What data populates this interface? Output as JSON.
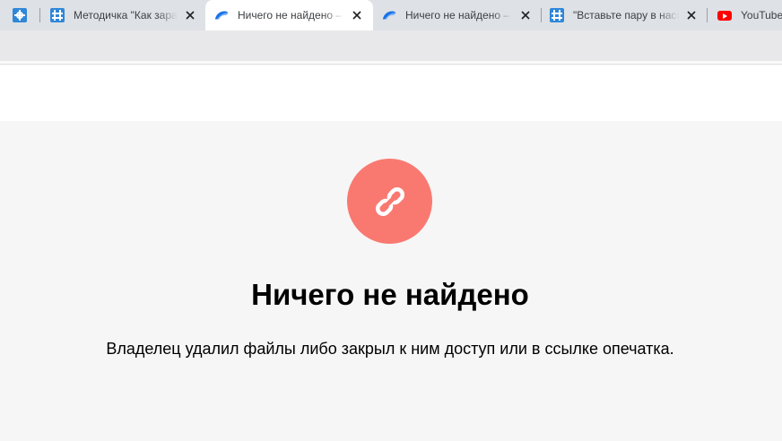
{
  "browser": {
    "tabs": [
      {
        "title": "",
        "favicon": "grid-favicon-icon",
        "active": false
      },
      {
        "title": "Методичка \"Как заработать\"",
        "favicon": "grid-favicon-icon",
        "active": false
      },
      {
        "title": "Ничего не найдено – Яндекс.Диск",
        "favicon": "yandex-disk-icon",
        "active": true
      },
      {
        "title": "Ничего не найдено – Яндекс.Диск",
        "favicon": "yandex-disk-icon",
        "active": false
      },
      {
        "title": "\"Вставьте пару в насос\"",
        "favicon": "grid-favicon-icon",
        "active": false
      },
      {
        "title": "YouTube",
        "favicon": "youtube-icon",
        "active": false
      }
    ]
  },
  "page": {
    "icon": "broken-link-icon",
    "icon_color": "#f97971",
    "title": "Ничего не найдено",
    "message": "Владелец удалил файлы либо закрыл к ним доступ или в ссылке опечатка."
  },
  "colors": {
    "tab_strip": "#dee1e6",
    "active_tab": "#ffffff",
    "page_background": "#f6f6f6",
    "youtube_red": "#ff0000",
    "grid_favicon": "#2f87d8"
  }
}
